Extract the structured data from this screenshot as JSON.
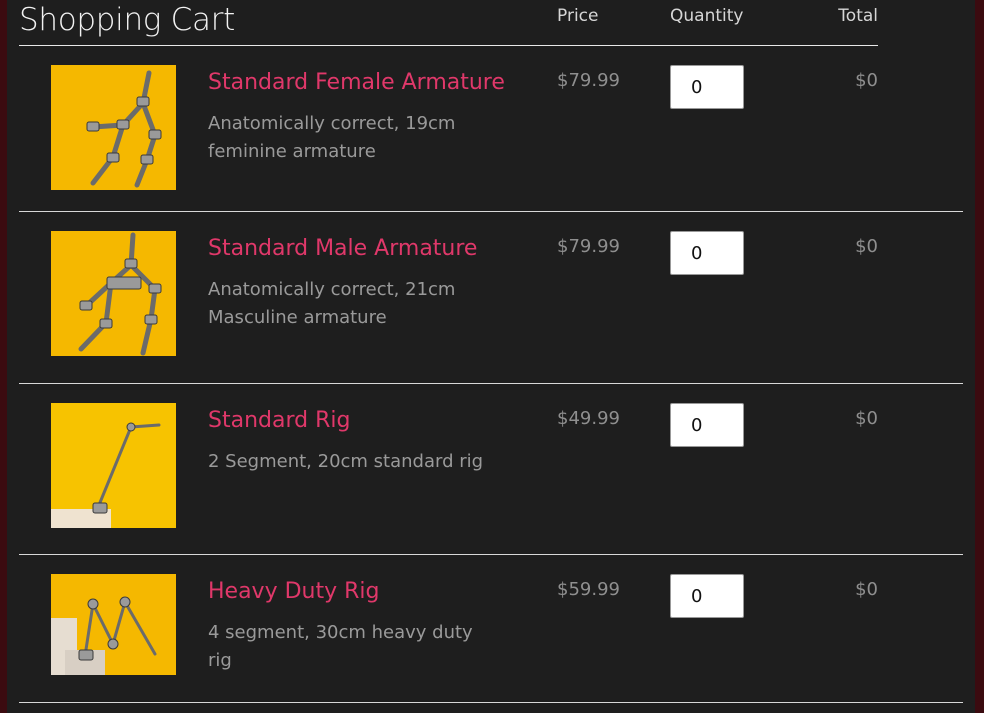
{
  "header": {
    "title": "Shopping Cart",
    "price_label": "Price",
    "quantity_label": "Quantity",
    "total_label": "Total"
  },
  "items": [
    {
      "name": "Standard Female Armature",
      "description": "Anatomically correct, 19cm feminine armature",
      "price": "$79.99",
      "quantity": "0",
      "total": "$0",
      "image_icon": "female-armature-image"
    },
    {
      "name": "Standard Male Armature",
      "description": "Anatomically correct, 21cm Masculine armature",
      "price": "$79.99",
      "quantity": "0",
      "total": "$0",
      "image_icon": "male-armature-image"
    },
    {
      "name": "Standard Rig",
      "description": "2 Segment, 20cm standard rig",
      "price": "$49.99",
      "quantity": "0",
      "total": "$0",
      "image_icon": "standard-rig-image"
    },
    {
      "name": "Heavy Duty Rig",
      "description": "4 segment, 30cm heavy duty rig",
      "price": "$59.99",
      "quantity": "0",
      "total": "$0",
      "image_icon": "heavy-duty-rig-image"
    }
  ],
  "colors": {
    "accent": "#e0386a",
    "background": "#1e1e1e",
    "frame": "#3b0b10",
    "product_image_bg": "#f5b800"
  }
}
